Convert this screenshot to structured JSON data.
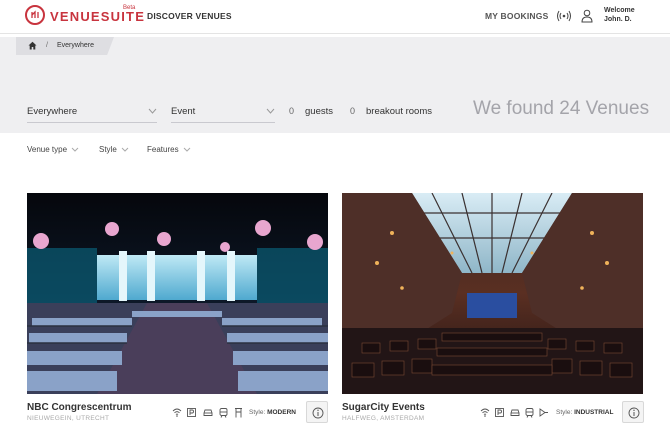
{
  "header": {
    "brand": "VENUESUITE",
    "beta": "Beta",
    "nav_discover": "DISCOVER VENUES",
    "nav_bookings": "MY BOOKINGS",
    "welcome_line1": "Welcome",
    "welcome_line2": "John. D.",
    "accent_color": "#c8343e"
  },
  "breadcrumb": {
    "separator": "/",
    "current": "Everywhere"
  },
  "filters": {
    "location": "Everywhere",
    "event_type": "Event",
    "guests_value": "0",
    "guests_label": "guests",
    "breakout_value": "0",
    "breakout_label": "breakout rooms",
    "results_text": "We found 24 Venues"
  },
  "sub_filters": {
    "venue_type": "Venue type",
    "style": "Style",
    "features": "Features"
  },
  "venues": [
    {
      "name": "NBC Congrescentrum",
      "location": "NIEUWEGEIN, UTRECHT",
      "style_label": "Style:",
      "style_value": "MODERN",
      "amenities": [
        "wifi-icon",
        "parking-icon",
        "car-icon",
        "train-icon",
        "accessible-icon"
      ]
    },
    {
      "name": "SugarCity Events",
      "location": "HALFWEG, AMSTERDAM",
      "style_label": "Style:",
      "style_value": "INDUSTRIAL",
      "amenities": [
        "wifi-icon",
        "parking-icon",
        "car-icon",
        "train-icon",
        "projector-icon"
      ]
    }
  ]
}
